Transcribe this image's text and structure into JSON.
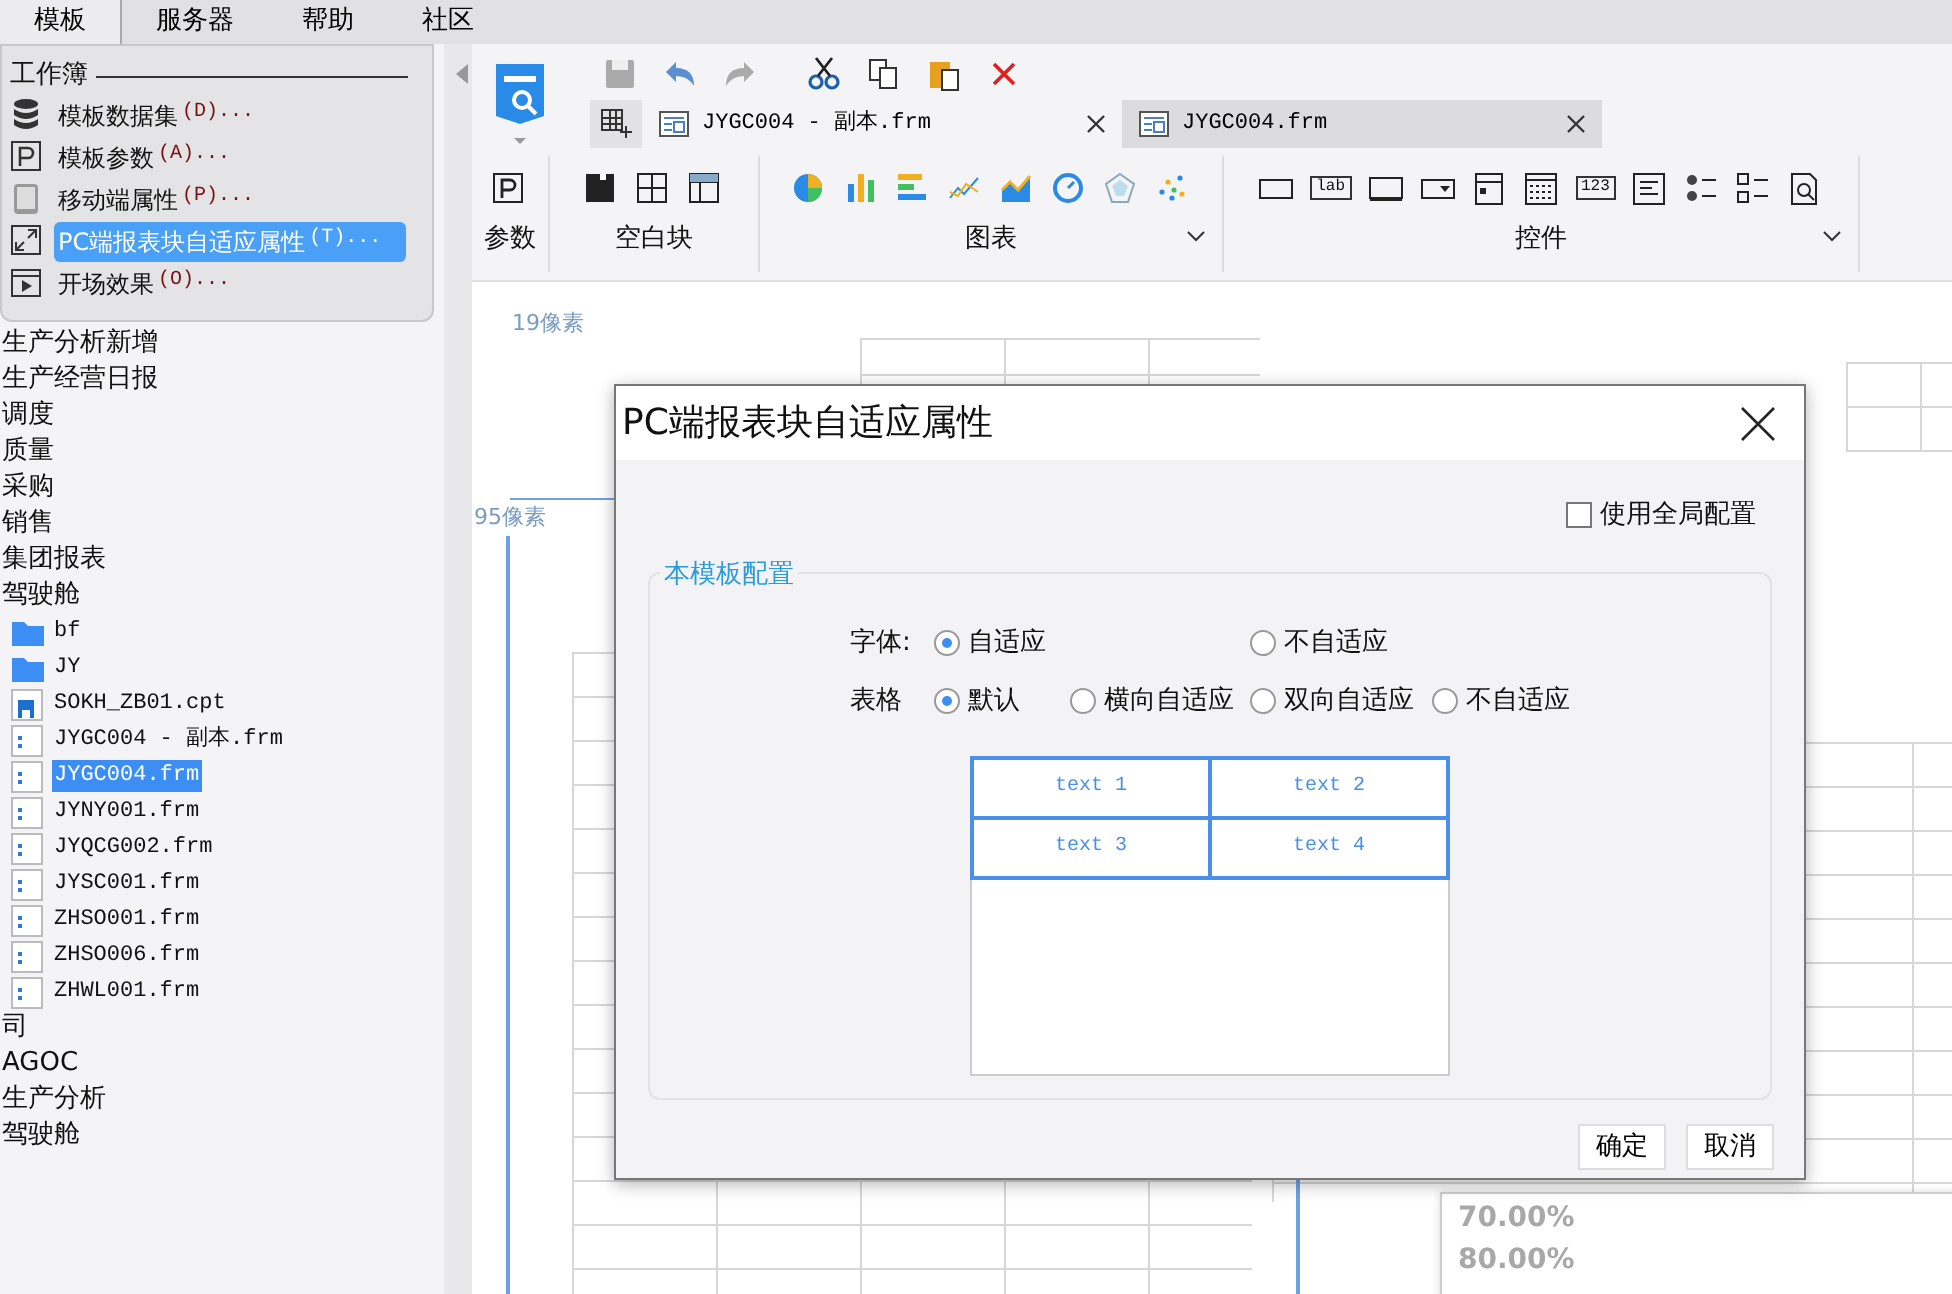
{
  "menu_bar": {
    "tabs": [
      {
        "label": "模板",
        "selected": true
      },
      {
        "label": "服务器",
        "selected": false
      },
      {
        "label": "帮助",
        "selected": false
      },
      {
        "label": "社区",
        "selected": false
      }
    ]
  },
  "template_menu": {
    "section": "工作簿",
    "items": [
      {
        "label": "模板数据集",
        "shortcut": "(D)...",
        "selected": false
      },
      {
        "label": "模板参数",
        "shortcut": "(A)...",
        "selected": false
      },
      {
        "label": "移动端属性",
        "shortcut": "(P)...",
        "selected": false
      },
      {
        "label": "PC端报表块自适应属性",
        "shortcut": "(T)...",
        "selected": true
      },
      {
        "label": "开场效果",
        "shortcut": "(O)...",
        "selected": false
      }
    ]
  },
  "sidebar": {
    "items": [
      {
        "label": "生产分析新增",
        "kind": "text",
        "selected": false
      },
      {
        "label": "生产经营日报",
        "kind": "text",
        "selected": false
      },
      {
        "label": "调度",
        "kind": "text",
        "selected": false
      },
      {
        "label": "质量",
        "kind": "text",
        "selected": false
      },
      {
        "label": "采购",
        "kind": "text",
        "selected": false
      },
      {
        "label": "销售",
        "kind": "text",
        "selected": false
      },
      {
        "label": "集团报表",
        "kind": "text",
        "selected": false
      },
      {
        "label": "驾驶舱",
        "kind": "text",
        "selected": false,
        "children": [
          {
            "label": "bf",
            "kind": "folder",
            "selected": false
          },
          {
            "label": "JY",
            "kind": "folder",
            "selected": false
          },
          {
            "label": "SOKH_ZB01.cpt",
            "kind": "cpt",
            "selected": false
          },
          {
            "label": "JYGC004 - 副本.frm",
            "kind": "frm",
            "selected": false
          },
          {
            "label": "JYGC004.frm",
            "kind": "frm",
            "selected": true
          },
          {
            "label": "JYNY001.frm",
            "kind": "frm",
            "selected": false
          },
          {
            "label": "JYQCG002.frm",
            "kind": "frm",
            "selected": false
          },
          {
            "label": "JYSC001.frm",
            "kind": "frm",
            "selected": false
          },
          {
            "label": "ZHSO001.frm",
            "kind": "frm",
            "selected": false
          },
          {
            "label": "ZHSO006.frm",
            "kind": "frm",
            "selected": false
          },
          {
            "label": "ZHWL001.frm",
            "kind": "frm",
            "selected": false
          }
        ]
      },
      {
        "label": "司",
        "kind": "text",
        "selected": false
      },
      {
        "label": "AGOC",
        "kind": "text",
        "selected": false
      },
      {
        "label": "生产分析",
        "kind": "text",
        "selected": false
      },
      {
        "label": "驾驶舱",
        "kind": "text",
        "selected": false
      }
    ]
  },
  "toolbar": {
    "document_tabs": [
      {
        "label": "JYGC004 - 副本.frm",
        "selected": true
      },
      {
        "label": "JYGC004.frm",
        "selected": false
      }
    ],
    "ribbon_groups": [
      {
        "label": "参数",
        "expandable": false
      },
      {
        "label": "空白块",
        "expandable": false
      },
      {
        "label": "图表",
        "expandable": true
      },
      {
        "label": "控件",
        "expandable": true
      }
    ],
    "widget_glyphs": [
      "lab",
      "123"
    ]
  },
  "canvas": {
    "ruler_labels": [
      "19像素",
      "95像素"
    ],
    "faint_labels": [
      "70.00%",
      "80.00%"
    ]
  },
  "dialog": {
    "title": "PC端报表块自适应属性",
    "use_global": {
      "label": "使用全局配置",
      "checked": false
    },
    "group_title": "本模板配置",
    "option_rows": [
      {
        "label": "字体:",
        "options": [
          {
            "label": "自适应",
            "selected": true
          },
          {
            "label": "不自适应",
            "selected": false
          }
        ]
      },
      {
        "label": "表格",
        "options": [
          {
            "label": "默认",
            "selected": true
          },
          {
            "label": "横向自适应",
            "selected": false
          },
          {
            "label": "双向自适应",
            "selected": false
          },
          {
            "label": "不自适应",
            "selected": false
          }
        ]
      }
    ],
    "preview_cells": [
      "text 1",
      "text 2",
      "text 3",
      "text 4"
    ],
    "buttons": [
      "确定",
      "取消"
    ]
  }
}
